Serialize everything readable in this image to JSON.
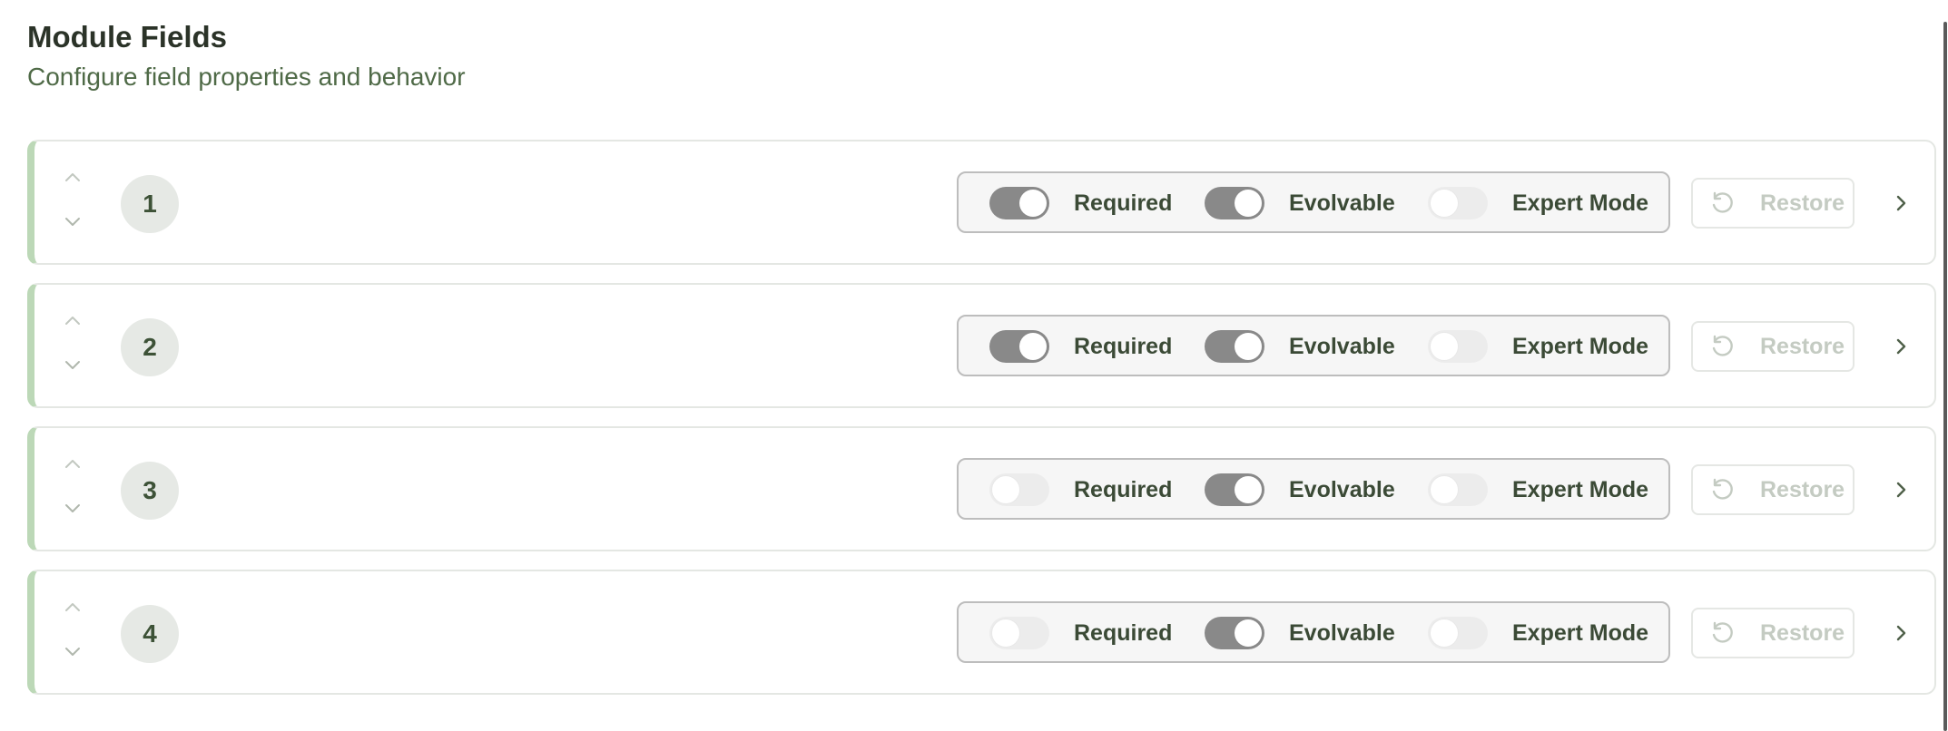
{
  "header": {
    "title": "Module Fields",
    "subtitle": "Configure field properties and behavior"
  },
  "fields": [
    {
      "order": "1",
      "required": true,
      "evolvable": true,
      "expert_mode": false
    },
    {
      "order": "2",
      "required": true,
      "evolvable": true,
      "expert_mode": false
    },
    {
      "order": "3",
      "required": false,
      "evolvable": true,
      "expert_mode": false
    },
    {
      "order": "4",
      "required": false,
      "evolvable": true,
      "expert_mode": false
    }
  ],
  "labels": {
    "required": "Required",
    "evolvable": "Evolvable",
    "expert_mode": "Expert Mode",
    "restore": "Restore"
  },
  "icons": {
    "move_up": "chevron-up-icon",
    "move_down": "chevron-down-icon",
    "restore": "restore-icon",
    "expand": "chevron-right-icon"
  },
  "colors": {
    "accent_border": "#bcd8b7",
    "toggle_on": "#898989",
    "toggle_off": "#ececec",
    "label_text": "#3b4a36",
    "disabled_text": "#c4cbc2"
  }
}
